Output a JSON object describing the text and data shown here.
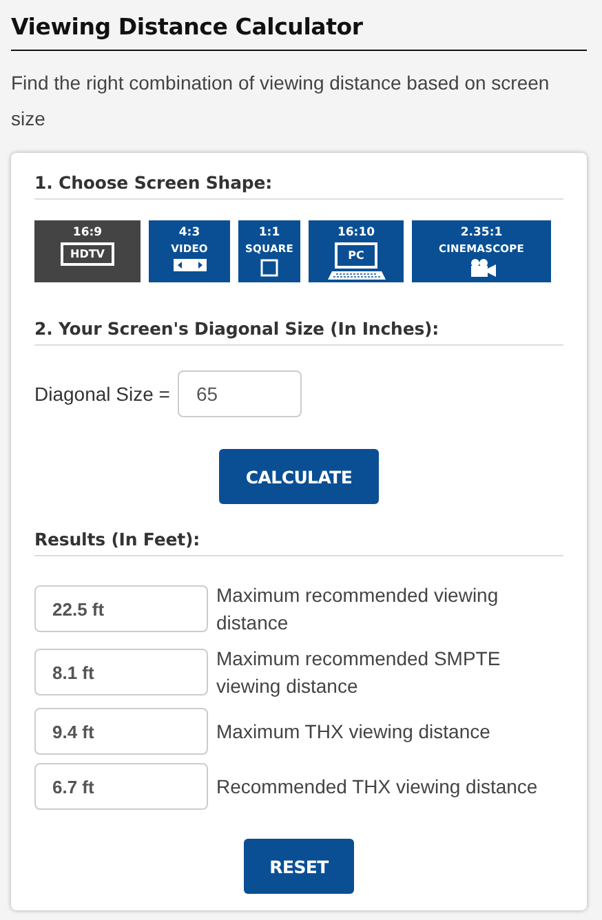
{
  "title": "Viewing Distance Calculator",
  "description": "Find the right combination of viewing distance based on screen size",
  "shape_section": {
    "heading": "1. Choose Screen Shape:",
    "shapes": [
      {
        "ratio": "16:9",
        "label": "HDTV",
        "kind": "screen",
        "selected": true
      },
      {
        "ratio": "4:3",
        "label": "VIDEO",
        "kind": "tape",
        "selected": false
      },
      {
        "ratio": "1:1",
        "label": "SQUARE",
        "kind": "square",
        "selected": false
      },
      {
        "ratio": "16:10",
        "label": "PC",
        "kind": "monitor",
        "selected": false
      },
      {
        "ratio": "2.35:1",
        "label": "CINEMASCOPE",
        "kind": "camera",
        "selected": false
      }
    ]
  },
  "size_section": {
    "heading": "2. Your Screen's Diagonal Size (In Inches):",
    "field_label": "Diagonal Size =",
    "value": "65",
    "button": "CALCULATE"
  },
  "results_section": {
    "heading": "Results (In Feet):",
    "results": [
      {
        "value": "22.5 ft",
        "description": "Maximum recommended viewing distance"
      },
      {
        "value": "8.1 ft",
        "description": "Maximum recommended SMPTE viewing distance"
      },
      {
        "value": "9.4 ft",
        "description": "Maximum THX viewing distance"
      },
      {
        "value": "6.7 ft",
        "description": "Recommended THX viewing distance"
      }
    ],
    "button": "RESET"
  }
}
